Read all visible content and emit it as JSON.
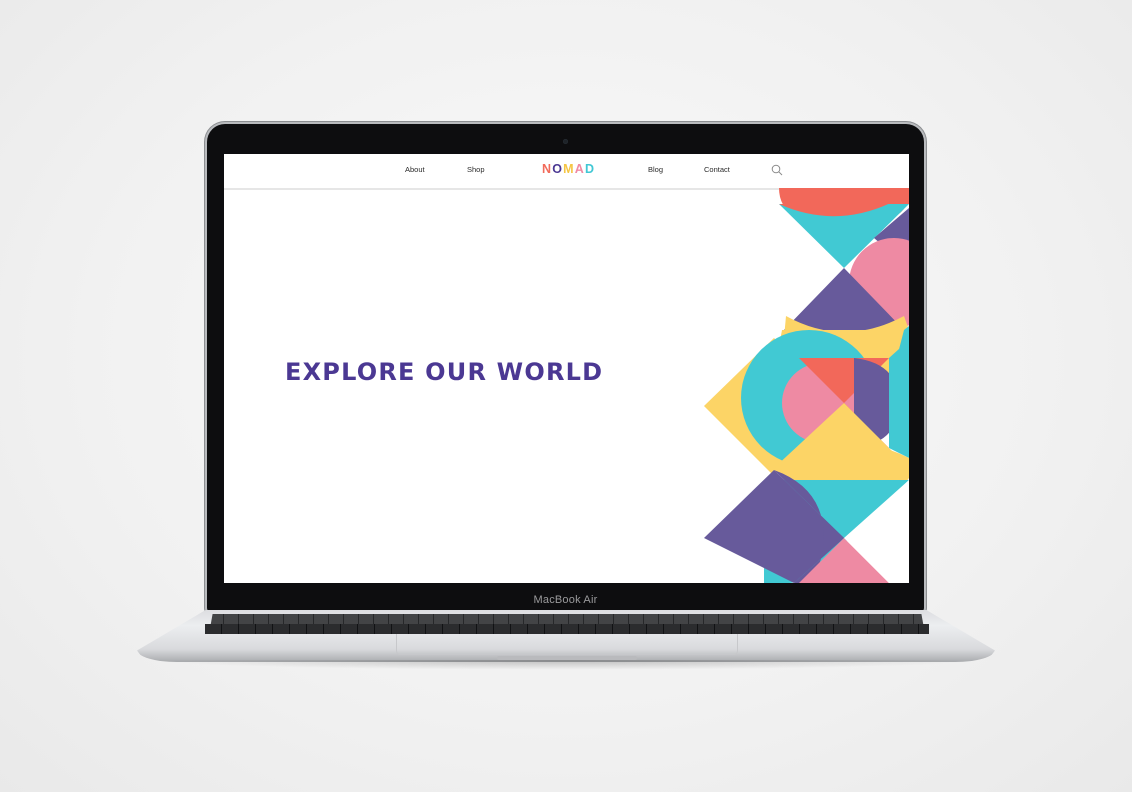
{
  "device": {
    "label": "MacBook Air"
  },
  "nav": {
    "links": [
      {
        "label": "About"
      },
      {
        "label": "Shop"
      },
      {
        "label": "Blog"
      },
      {
        "label": "Contact"
      }
    ],
    "logo": {
      "text": "NOMAD",
      "letter_colors": [
        "#f26b5b",
        "#4b3893",
        "#f5c543",
        "#f08aa3",
        "#41c7d4"
      ]
    },
    "search_icon": "search-icon"
  },
  "hero": {
    "title": "EXPLORE OUR WORLD",
    "title_color": "#4b3893"
  },
  "palette": {
    "purple": "#675a9b",
    "coral": "#f2685a",
    "teal": "#41c9d3",
    "pink": "#ee8aa3",
    "yellow": "#fcd466"
  }
}
